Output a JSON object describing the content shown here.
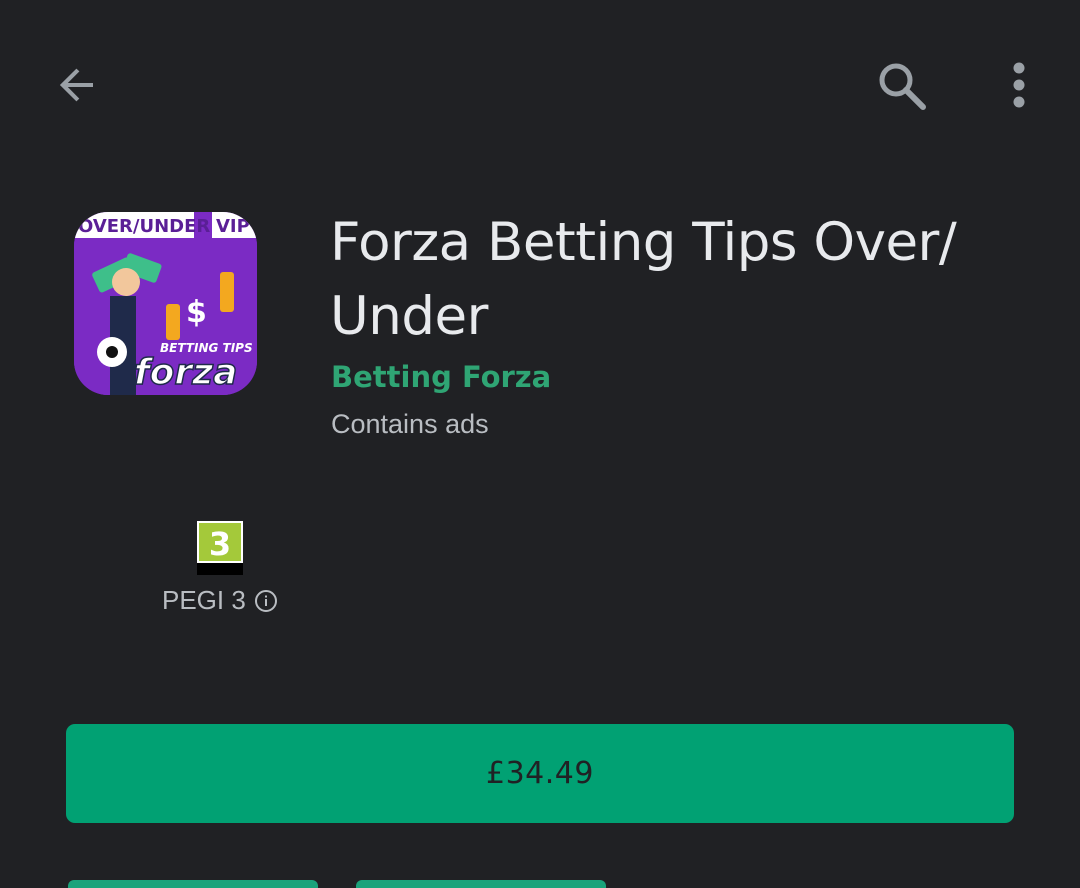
{
  "topbar": {
    "back_icon": "arrow-left-icon",
    "search_icon": "search-icon",
    "more_icon": "more-vert-icon"
  },
  "app": {
    "title": "Forza Betting Tips Over/ Under",
    "developer": "Betting Forza",
    "ads_note": "Contains ads",
    "icon_texts": {
      "top_left": "OVER/UNDER",
      "top_right": "VIP",
      "middle": "BETTING TIPS",
      "brand": "forza"
    },
    "accent_color": "#01a173",
    "developer_color": "#2fa574"
  },
  "rating": {
    "badge_number": "3",
    "label": "PEGI 3",
    "info_icon": "info-icon"
  },
  "purchase": {
    "price_label": "£34.49"
  }
}
